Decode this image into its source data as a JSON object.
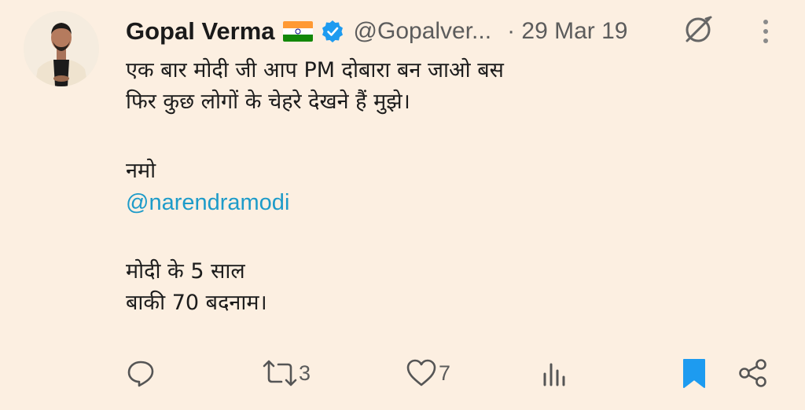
{
  "tweet": {
    "author_name": "Gopal Verma",
    "handle": "@Gopalver...",
    "date": "· 29 Mar 19",
    "lines_1": [
      "एक बार मोदी जी आप PM दोबारा बन जाओ बस",
      "फिर कुछ लोगों के चेहरे देखने हैं मुझे।"
    ],
    "line_namo": "नमो",
    "mention": "@narendramodi",
    "lines_2": [
      "मोदी के 5 साल",
      "बाकी 70 बदनाम।"
    ]
  },
  "icons": {
    "flag": "india-flag-icon",
    "verified": "verified-badge-icon",
    "grok": "grok-icon",
    "more": "more-vertical-icon",
    "reply": "reply-icon",
    "retweet": "retweet-icon",
    "like": "heart-icon",
    "views": "views-icon",
    "bookmark": "bookmark-icon",
    "share": "share-icon"
  },
  "actions": {
    "reply_count": "",
    "retweet_count": "3",
    "like_count": "7"
  },
  "colors": {
    "background": "#fcefe1",
    "text": "#1c1c1c",
    "secondary_text": "#5c5c5c",
    "link": "#1d9bc9",
    "verified": "#1d9bf0",
    "bookmark_active": "#1d9bf0"
  }
}
